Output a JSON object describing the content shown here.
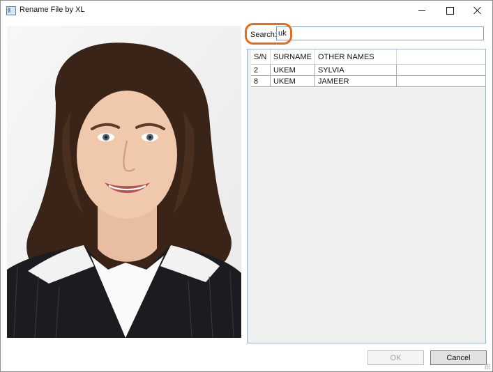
{
  "window": {
    "title": "Rename File by XL"
  },
  "search": {
    "label": "Search:",
    "value": "uk"
  },
  "table": {
    "columns": [
      "S/N",
      "SURNAME",
      "OTHER NAMES"
    ],
    "rows": [
      [
        "2",
        "UKEM",
        "SYLVIA"
      ],
      [
        "8",
        "UKEM",
        "JAMEER"
      ]
    ]
  },
  "buttons": {
    "ok": "OK",
    "cancel": "Cancel"
  },
  "colors": {
    "highlight": "#e36c1e",
    "input_border": "#7a9fc4"
  }
}
